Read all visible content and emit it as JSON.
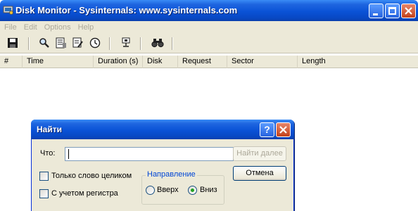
{
  "window": {
    "title": "Disk Monitor - Sysinternals: www.sysinternals.com"
  },
  "menu": [
    "File",
    "Edit",
    "Options",
    "Help"
  ],
  "toolbar": {
    "buttons": [
      "save-icon",
      "search-icon",
      "filter-icon",
      "highlight-icon",
      "clock-icon",
      "network-icon",
      "find-icon"
    ]
  },
  "list": {
    "columns": [
      "#",
      "Time",
      "Duration (s)",
      "Disk",
      "Request",
      "Sector",
      "Length"
    ]
  },
  "find_dialog": {
    "title": "Найти",
    "help_label": "?",
    "what_label": "Что:",
    "what_value": "",
    "find_next_label": "Найти далее",
    "cancel_label": "Отмена",
    "whole_word_label": "Только слово целиком",
    "whole_word_checked": false,
    "match_case_label": "С учетом регистра",
    "match_case_checked": false,
    "direction_legend": "Направление",
    "direction_up_label": "Вверх",
    "direction_down_label": "Вниз",
    "direction_selected": "down"
  },
  "colors": {
    "titlebar": "#0a52d6",
    "face": "#ece9d8",
    "accent": "#0046d5",
    "close": "#c4411a"
  }
}
